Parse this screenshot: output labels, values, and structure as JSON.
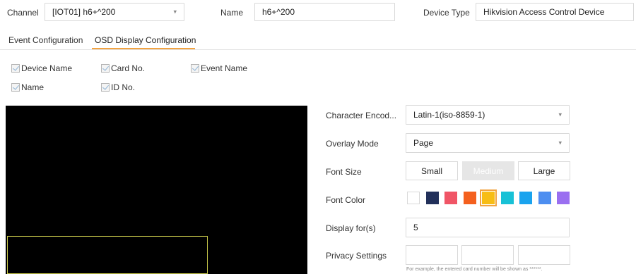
{
  "header": {
    "channel_label": "Channel",
    "channel_value": "[IOT01] h6+^200",
    "name_label": "Name",
    "name_value": "h6+^200",
    "device_type_label": "Device Type",
    "device_type_value": "Hikvision Access Control Device"
  },
  "tabs": [
    {
      "label": "Event Configuration",
      "active": false
    },
    {
      "label": "OSD Display Configuration",
      "active": true
    }
  ],
  "checkboxes": [
    {
      "label": "Device Name",
      "checked": true
    },
    {
      "label": "Card No.",
      "checked": true
    },
    {
      "label": "Event Name",
      "checked": true
    },
    {
      "label": "Name",
      "checked": true
    },
    {
      "label": "ID No.",
      "checked": true
    }
  ],
  "settings": {
    "char_encoding_label": "Character Encod...",
    "char_encoding_value": "Latin-1(iso-8859-1)",
    "overlay_mode_label": "Overlay Mode",
    "overlay_mode_value": "Page",
    "font_size_label": "Font Size",
    "font_size_options": [
      "Small",
      "Medium",
      "Large"
    ],
    "font_size_selected": "Medium",
    "font_color_label": "Font Color",
    "font_colors": [
      "#ffffff",
      "#22305a",
      "#f05566",
      "#f4601e",
      "#f7bd15",
      "#18c1d6",
      "#1aa3ee",
      "#4d8ef0",
      "#9a6ff0"
    ],
    "font_color_selected": "#f7bd15",
    "display_for_label": "Display for(s)",
    "display_for_value": "5",
    "privacy_label": "Privacy Settings",
    "privacy_hint": "For example, the entered card number will be shown as ******."
  }
}
